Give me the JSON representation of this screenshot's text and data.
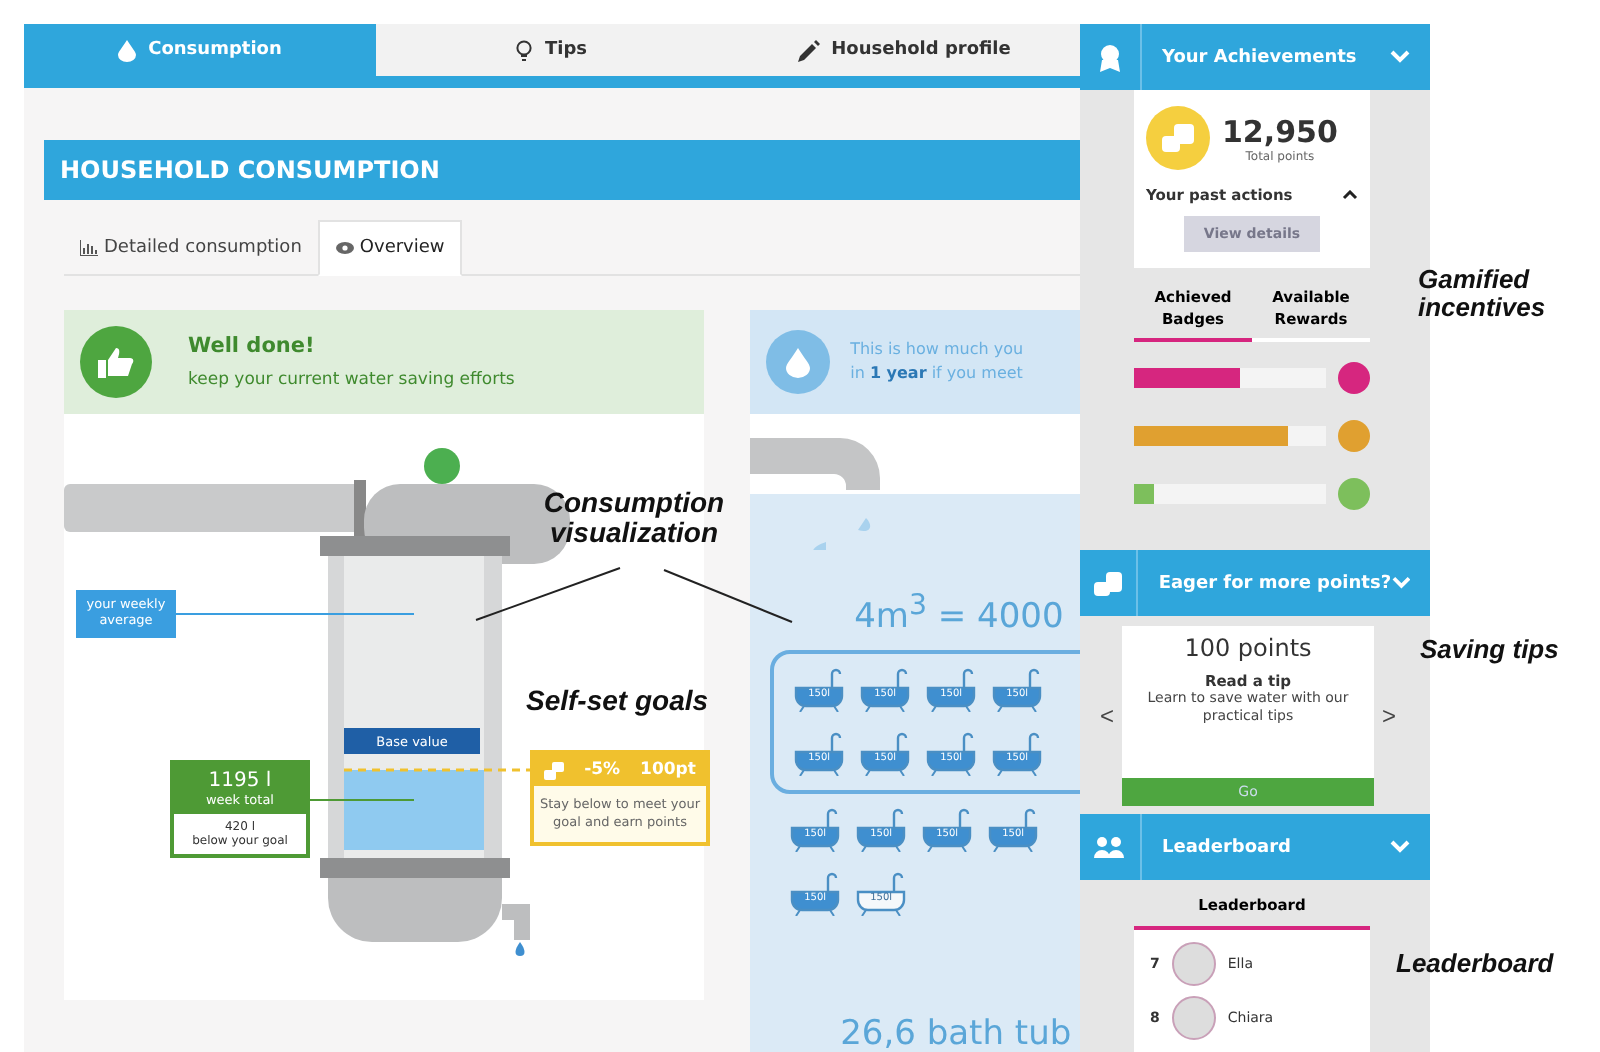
{
  "tabs": [
    {
      "label": "Consumption",
      "selected": true
    },
    {
      "label": "Tips",
      "selected": false
    },
    {
      "label": "Household profile",
      "selected": false
    }
  ],
  "panel": {
    "title": "HOUSEHOLD CONSUMPTION",
    "subtabs": [
      {
        "label": "Detailed consumption",
        "selected": false
      },
      {
        "label": "Overview",
        "selected": true
      }
    ]
  },
  "status_card": {
    "title": "Well done!",
    "message": "keep your current water saving efforts"
  },
  "tank": {
    "average_label": "your weekly average",
    "base_label": "Base value",
    "total": "1195 l",
    "total_caption": "week total",
    "below": "420 l",
    "below_caption": "below your goal",
    "goal_change": "-5%",
    "goal_points": "100pt",
    "goal_hint": "Stay below to meet your goal and earn points"
  },
  "yearly": {
    "intro": "This is how much you",
    "intro_2": "in **1 year** if you meet",
    "equation": "4m$^{3}$ = 4000",
    "summary": "26,6 bath tub",
    "bathtubs": [
      {
        "label": "150l",
        "full": true
      },
      {
        "label": "150l",
        "full": true
      },
      {
        "label": "150l",
        "full": true
      },
      {
        "label": "150l",
        "full": true
      },
      {
        "label": "150l",
        "full": true
      },
      {
        "label": "150l",
        "full": true
      },
      {
        "label": "150l",
        "full": true
      },
      {
        "label": "150l",
        "full": true
      },
      {
        "label": "150l",
        "full": true
      },
      {
        "label": "150l",
        "full": true
      },
      {
        "label": "150l",
        "full": true
      },
      {
        "label": "150l",
        "full": true
      },
      {
        "label": "150l",
        "full": true
      },
      {
        "label": "150l",
        "full": false
      }
    ]
  },
  "achievements": {
    "title": "Your Achievements",
    "points": "12,950",
    "points_caption": "Total points",
    "past_actions": "Your past actions",
    "details_button": {
      "label": "View details",
      "disabled": true
    },
    "tabs": [
      {
        "label": "Achieved Badges",
        "selected": true
      },
      {
        "label": "Available Rewards",
        "selected": false
      }
    ],
    "badges": [
      {
        "level": 0.55,
        "color": "#d6267f"
      },
      {
        "level": 0.8,
        "color": "#e0a030"
      },
      {
        "level": 0.1,
        "color": "#7dbf5c"
      }
    ]
  },
  "tip_offer": {
    "title": "Eager for more points?",
    "points": "100 points",
    "heading": "Read a tip",
    "text": "Learn to save water with our practical tips",
    "button": "Go",
    "prev": "<",
    "next": ">"
  },
  "leaderboard": {
    "title": "Leaderboard",
    "tabs": [
      {
        "label": "Leaderboard",
        "selected": true
      }
    ],
    "rows": [
      {
        "rank": "7",
        "name": "Ella"
      },
      {
        "rank": "8",
        "name": "Chiara"
      }
    ]
  },
  "annotations": [
    {
      "text": "Consumption visualization"
    },
    {
      "text": "Self-set goals"
    },
    {
      "text": "Gamified incentives"
    },
    {
      "text": "Saving tips"
    },
    {
      "text": "Leaderboard"
    }
  ]
}
